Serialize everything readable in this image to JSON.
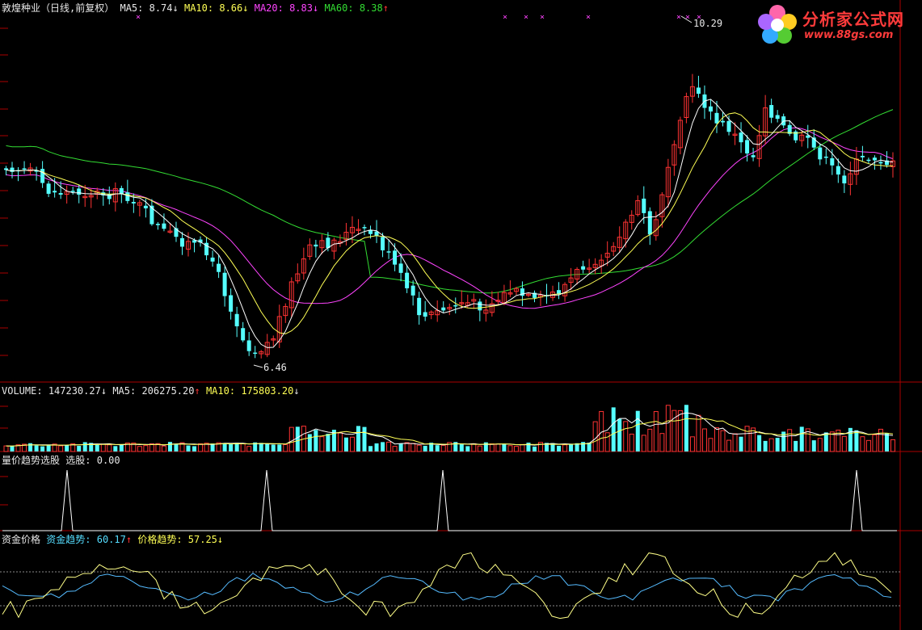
{
  "price_panel": {
    "stock_label": "敦煌种业（日线,前复权）",
    "ma5_label": "MA5:",
    "ma5_value": "8.74",
    "ma5_arrow": "↓",
    "ma10_label": "MA10:",
    "ma10_value": "8.66",
    "ma10_arrow": "↓",
    "ma20_label": "MA20:",
    "ma20_value": "8.83",
    "ma20_arrow": "↓",
    "ma60_label": "MA60:",
    "ma60_value": "8.38",
    "ma60_arrow": "↑",
    "high_label": "10.29",
    "low_label": "6.46"
  },
  "volume_panel": {
    "volume_label": "VOLUME:",
    "volume_value": "147230.27",
    "volume_arrow": "↓",
    "ma5_label": "MA5:",
    "ma5_value": "206275.20",
    "ma5_arrow": "↑",
    "ma10_label": "MA10:",
    "ma10_value": "175803.20",
    "ma10_arrow": "↓"
  },
  "signal_panel": {
    "indicator_name": "量价趋势选股",
    "value_label": "选股:",
    "value": "0.00"
  },
  "flow_panel": {
    "indicator_name": "资金价格",
    "fund_label": "资金趋势:",
    "fund_value": "60.17",
    "fund_arrow": "↑",
    "price_label": "价格趋势:",
    "price_value": "57.25",
    "price_arrow": "↓"
  },
  "logo": {
    "title": "分析家公式网",
    "url": "www.88gs.com"
  },
  "colors": {
    "up": "#ff3333",
    "down": "#55ffff",
    "ma5": "#ffffff",
    "ma10": "#ffff55",
    "ma20": "#ff44ff",
    "ma60": "#33dd33",
    "fund": "#55bbff",
    "price_trend": "#ffff88",
    "border": "#aa0000"
  },
  "chart_data": [
    {
      "type": "candlestick",
      "panel": "price",
      "price_range": [
        6.46,
        10.29
      ],
      "series": [
        {
          "name": "MA5",
          "value": 8.74
        },
        {
          "name": "MA10",
          "value": 8.66
        },
        {
          "name": "MA20",
          "value": 8.83
        },
        {
          "name": "MA60",
          "value": 8.38
        }
      ]
    },
    {
      "type": "bar",
      "panel": "volume",
      "series": [
        {
          "name": "VOLUME",
          "value": 147230.27
        },
        {
          "name": "MA5",
          "value": 206275.2
        },
        {
          "name": "MA10",
          "value": 175803.2
        }
      ]
    },
    {
      "type": "line",
      "panel": "signal",
      "series": [
        {
          "name": "选股",
          "value": 0.0
        }
      ]
    },
    {
      "type": "line",
      "panel": "fund-price",
      "series": [
        {
          "name": "资金趋势",
          "value": 60.17
        },
        {
          "name": "价格趋势",
          "value": 57.25
        }
      ]
    }
  ]
}
